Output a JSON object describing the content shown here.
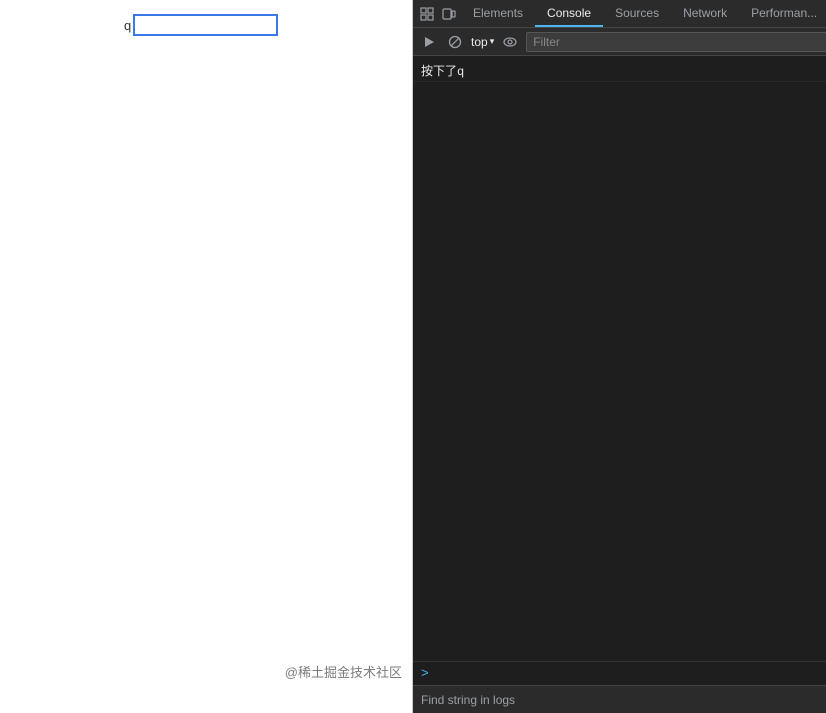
{
  "page": {
    "input_label": "q",
    "input_value": "",
    "input_placeholder": "",
    "watermark": "@稀土掘金技术社区"
  },
  "devtools": {
    "tabs": [
      {
        "id": "elements",
        "label": "Elements",
        "active": false
      },
      {
        "id": "console",
        "label": "Console",
        "active": true
      },
      {
        "id": "sources",
        "label": "Sources",
        "active": false
      },
      {
        "id": "network",
        "label": "Network",
        "active": false
      },
      {
        "id": "performance",
        "label": "Performan...",
        "active": false
      }
    ],
    "toolbar": {
      "top_label": "top",
      "filter_placeholder": "Filter"
    },
    "console": {
      "log_entry": "按下了q",
      "prompt_symbol": ">"
    },
    "find_bar": {
      "placeholder": "Find string in logs"
    }
  }
}
